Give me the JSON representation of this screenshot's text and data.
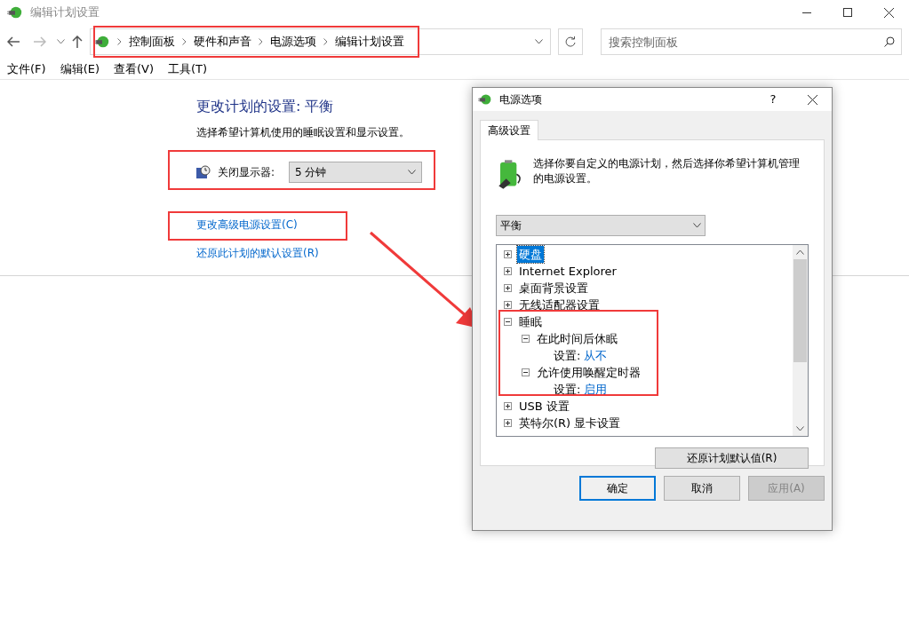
{
  "window": {
    "title": "编辑计划设置"
  },
  "breadcrumb": [
    "控制面板",
    "硬件和声音",
    "电源选项",
    "编辑计划设置"
  ],
  "search": {
    "placeholder": "搜索控制面板"
  },
  "menu": [
    "文件(F)",
    "编辑(E)",
    "查看(V)",
    "工具(T)"
  ],
  "plan": {
    "heading": "更改计划的设置: 平衡",
    "description": "选择希望计算机使用的睡眠设置和显示设置。",
    "display_label": "关闭显示器:",
    "display_value": "5 分钟",
    "links": [
      "更改高级电源设置(C)",
      "还原此计划的默认设置(R)"
    ]
  },
  "dialog": {
    "title": "电源选项",
    "help": "?",
    "tabs": [
      {
        "label": "高级设置",
        "selected": true
      }
    ],
    "intro": "选择你要自定义的电源计划，然后选择你希望计算机管理的电源设置。",
    "plan_select": "平衡",
    "tree": [
      {
        "label": "硬盘",
        "expanded": false,
        "selected": true
      },
      {
        "label": "Internet Explorer",
        "expanded": false,
        "selected": false
      },
      {
        "label": "桌面背景设置",
        "expanded": false,
        "selected": false
      },
      {
        "label": "无线适配器设置",
        "expanded": false,
        "selected": false
      },
      {
        "label": "睡眠",
        "expanded": true,
        "selected": false,
        "children": [
          {
            "label": "在此时间后休眠",
            "expanded": true,
            "selected": false,
            "setting_label": "设置:",
            "setting_value": "从不"
          },
          {
            "label": "允许使用唤醒定时器",
            "expanded": true,
            "selected": false,
            "setting_label": "设置:",
            "setting_value": "启用"
          }
        ]
      },
      {
        "label": "USB 设置",
        "expanded": false,
        "selected": false
      },
      {
        "label": "英特尔(R) 显卡设置",
        "expanded": false,
        "selected": false
      }
    ],
    "restore_button": "还原计划默认值(R)",
    "buttons": [
      {
        "label": "确定",
        "disabled": false,
        "default": true
      },
      {
        "label": "取消",
        "disabled": false,
        "default": false
      },
      {
        "label": "应用(A)",
        "disabled": true,
        "default": false
      }
    ]
  }
}
